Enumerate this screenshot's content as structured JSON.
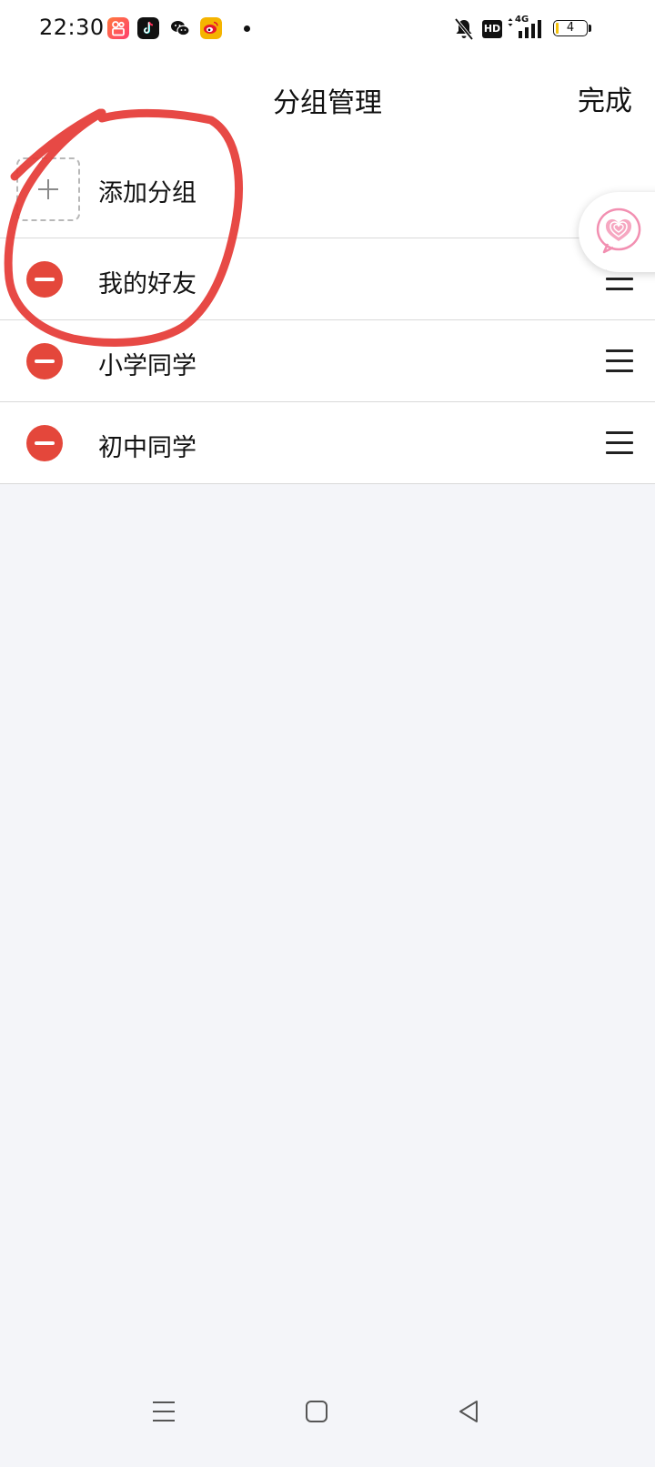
{
  "status_bar": {
    "time": "22:30",
    "battery": "4",
    "network": "4G",
    "hd_label": "HD"
  },
  "header": {
    "title": "分组管理",
    "done_label": "完成"
  },
  "add_group": {
    "label": "添加分组"
  },
  "groups": [
    {
      "label": "我的好友"
    },
    {
      "label": "小学同学"
    },
    {
      "label": "初中同学"
    }
  ],
  "colors": {
    "delete_red": "#e4473b",
    "annotation_red": "#e53935",
    "background": "#f4f5f9"
  }
}
